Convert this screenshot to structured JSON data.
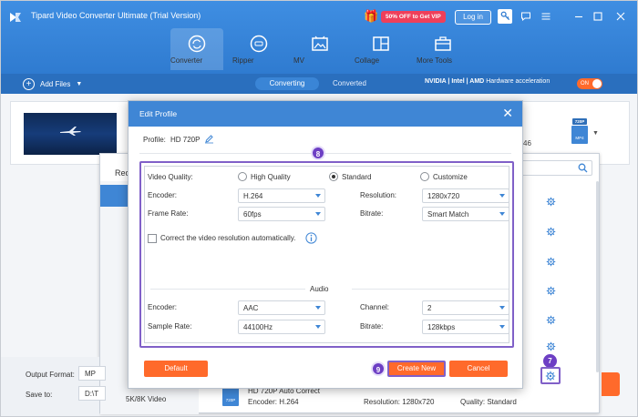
{
  "app": {
    "title": "Tipard Video Converter Ultimate (Trial Version)",
    "promo": "50% OFF to Get VIP",
    "login": "Log in",
    "icons": [
      "logo-icon",
      "gift-icon",
      "key-icon",
      "chat-icon",
      "menu-icon",
      "minimize-icon",
      "maximize-icon",
      "close-icon"
    ]
  },
  "nav": {
    "tabs": [
      {
        "label": "Converter",
        "icon": "converter-icon",
        "active": true
      },
      {
        "label": "Ripper",
        "icon": "ripper-icon"
      },
      {
        "label": "MV",
        "icon": "mv-icon"
      },
      {
        "label": "Collage",
        "icon": "collage-icon"
      },
      {
        "label": "More Tools",
        "icon": "toolbox-icon"
      }
    ]
  },
  "subbar": {
    "add_files": "Add Files",
    "converting": "Converting",
    "converted": "Converted",
    "hw_brands": "NVIDIA | Intel | AMD",
    "hw_label": "Hardware acceleration",
    "toggle": "ON"
  },
  "file": {
    "res_fragment": "46",
    "chip_tag": "720P",
    "chip_ext": "MP4"
  },
  "format_panel": {
    "tab_fragment": "Rec",
    "last_category": "5K/8K Video",
    "item": {
      "badge": "720P",
      "title": "HD 720P Auto Correct",
      "encoder": "Encoder: H.264",
      "resolution": "Resolution: 1280x720",
      "quality": "Quality: Standard"
    }
  },
  "bottom": {
    "output_format_label": "Output Format:",
    "output_format_value": "MP",
    "save_to_label": "Save to:",
    "save_to_value": "D:\\T"
  },
  "dialog": {
    "title": "Edit Profile",
    "profile_label": "Profile:",
    "profile_value": "HD 720P",
    "video": {
      "quality_label": "Video Quality:",
      "quality_options": [
        "High Quality",
        "Standard",
        "Customize"
      ],
      "quality_selected": "Standard",
      "encoder_label": "Encoder:",
      "encoder_value": "H.264",
      "resolution_label": "Resolution:",
      "resolution_value": "1280x720",
      "frame_rate_label": "Frame Rate:",
      "frame_rate_value": "60fps",
      "bitrate_label": "Bitrate:",
      "bitrate_value": "Smart Match",
      "auto_correct_label": "Correct the video resolution automatically.",
      "auto_correct_checked": false
    },
    "audio": {
      "section_label": "Audio",
      "encoder_label": "Encoder:",
      "encoder_value": "AAC",
      "channel_label": "Channel:",
      "channel_value": "2",
      "sample_rate_label": "Sample Rate:",
      "sample_rate_value": "44100Hz",
      "bitrate_label": "Bitrate:",
      "bitrate_value": "128kbps"
    },
    "buttons": {
      "default": "Default",
      "create_new": "Create New",
      "cancel": "Cancel"
    }
  },
  "annotations": {
    "step7": "7",
    "step8": "8",
    "step9": "9"
  },
  "colors": {
    "brand_blue": "#3f86d5",
    "accent_orange": "#ff6a2b",
    "annotation_purple": "#8060c8"
  }
}
